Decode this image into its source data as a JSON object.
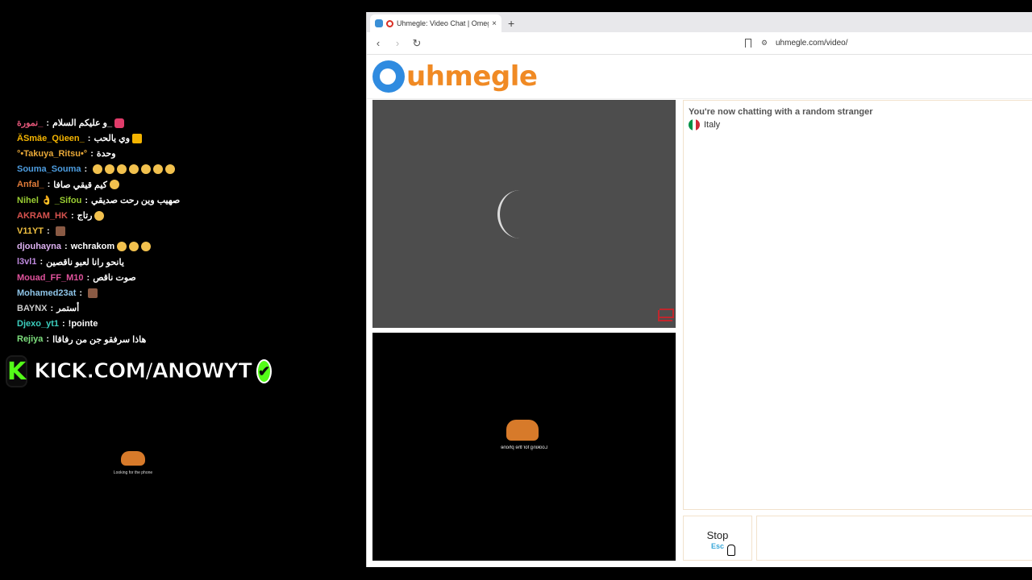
{
  "chat": [
    {
      "user": "نمورة_",
      "msg": "و عليكم السلام_",
      "color": "#e6577a",
      "emotes": [
        "bow"
      ]
    },
    {
      "user": "ÄSmäe_Qüeen_",
      "msg": "وي يالحب",
      "color": "#f4b400",
      "emotes": [
        "crown"
      ]
    },
    {
      "user": "°•Takuya_Ritsu•°",
      "msg": "وحدة",
      "color": "#e8a838",
      "emotes": []
    },
    {
      "user": "Souma_Souma",
      "msg": "",
      "color": "#4d9de0",
      "emotes": [
        "e",
        "e",
        "e",
        "e",
        "e",
        "e",
        "e"
      ]
    },
    {
      "user": "Anfal_",
      "msg": "كيم قيقي صافا",
      "color": "#e07b39",
      "emotes": [
        "e"
      ]
    },
    {
      "user": "Nihel 👌 _Sifou",
      "msg": "صهيب وين رحت صديقي",
      "color": "#9acd32",
      "emotes": []
    },
    {
      "user": "AKRAM_HK",
      "msg": "رتاج",
      "color": "#d9534f",
      "emotes": [
        "e"
      ]
    },
    {
      "user": "V11YT",
      "msg": "",
      "color": "#f0c040",
      "emotes": [
        "sq"
      ]
    },
    {
      "user": "djouhayna",
      "msg": "wchrakom",
      "color": "#dcb0f0",
      "emotes": [
        "e",
        "e",
        "e"
      ]
    },
    {
      "user": "l3vl1",
      "msg": "يانحو رانا لعبو ناقصين",
      "color": "#c08ae0",
      "emotes": []
    },
    {
      "user": "Mouad_FF_M10",
      "msg": "صوت ناقص",
      "color": "#e0529c",
      "emotes": []
    },
    {
      "user": "Mohamed23at",
      "msg": "",
      "color": "#8ec5e8",
      "emotes": [
        "sq"
      ]
    },
    {
      "user": "BAYNX",
      "msg": "أستمر",
      "color": "#cccccc",
      "emotes": []
    },
    {
      "user": "Djexo_yt1",
      "msg": "!pointe",
      "color": "#3ccfbf",
      "emotes": []
    },
    {
      "user": "Rejiya",
      "msg": "هاذا سرفقو جن من رفاقاا",
      "color": "#7ee07e",
      "emotes": []
    }
  ],
  "kick": {
    "logo": "K",
    "text": "KICK.COM/ANOWYT",
    "verified": "✔"
  },
  "mini_cat_label": "Looking for the phone",
  "browser": {
    "tab_title": "Uhmegle: Video Chat | Omeg",
    "tab_close": "×",
    "new_tab": "+",
    "url": "uhmegle.com/video/"
  },
  "site": {
    "logo_text": "uhmegle",
    "status": "You're now chatting with a random stranger",
    "country": "Italy",
    "stop_label": "Stop",
    "stop_key": "Esc",
    "local_label": "Looking for the phone"
  },
  "colors": {
    "accent": "#f08a24",
    "brand_blue": "#2f8be0",
    "kick_green": "#53fc18",
    "report_red": "#c0272d"
  }
}
